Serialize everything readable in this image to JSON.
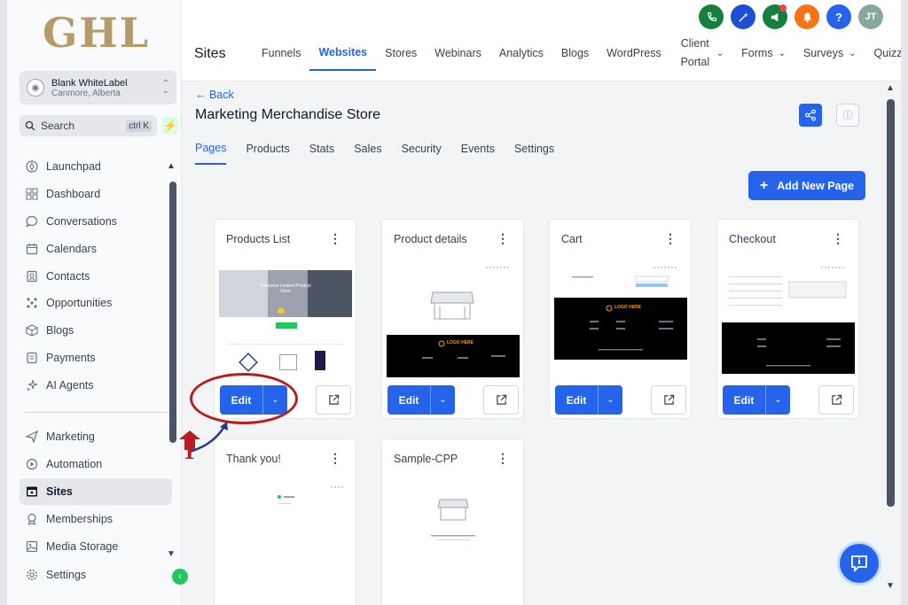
{
  "brand": {
    "logo_text": "GHL"
  },
  "account": {
    "name": "Blank WhiteLabel",
    "location": "Canmore, Alberta"
  },
  "search": {
    "label": "Search",
    "shortcut": "ctrl K"
  },
  "sidebar": {
    "items": [
      {
        "label": "Launchpad",
        "icon": "rocket-icon"
      },
      {
        "label": "Dashboard",
        "icon": "grid-icon"
      },
      {
        "label": "Conversations",
        "icon": "chat-icon"
      },
      {
        "label": "Calendars",
        "icon": "calendar-icon"
      },
      {
        "label": "Contacts",
        "icon": "contacts-icon"
      },
      {
        "label": "Opportunities",
        "icon": "opportunities-icon"
      },
      {
        "label": "Blogs",
        "icon": "cube-icon"
      },
      {
        "label": "Payments",
        "icon": "payments-icon"
      },
      {
        "label": "AI Agents",
        "icon": "sparkle-icon"
      }
    ],
    "items2": [
      {
        "label": "Marketing",
        "icon": "send-icon"
      },
      {
        "label": "Automation",
        "icon": "automation-icon"
      },
      {
        "label": "Sites",
        "icon": "sites-icon",
        "active": true
      },
      {
        "label": "Memberships",
        "icon": "badge-icon"
      },
      {
        "label": "Media Storage",
        "icon": "image-icon"
      },
      {
        "label": "Settings",
        "icon": "gear-icon"
      }
    ]
  },
  "topbar": {
    "section_title": "Sites",
    "tabs": [
      "Funnels",
      "Websites",
      "Stores",
      "Webinars",
      "Analytics",
      "Blogs",
      "WordPress",
      "Client Portal",
      "Forms",
      "Surveys",
      "Quizzes"
    ],
    "active_tab": "Websites",
    "user_initials": "JT",
    "help_label": "?"
  },
  "page": {
    "back_label": "← Back",
    "title": "Marketing Merchandise Store",
    "subtabs": [
      "Pages",
      "Products",
      "Stats",
      "Sales",
      "Security",
      "Events",
      "Settings"
    ],
    "active_subtab": "Pages",
    "add_button": "Add New Page",
    "edit_label": "Edit"
  },
  "cards": [
    {
      "title": "Products List"
    },
    {
      "title": "Product details"
    },
    {
      "title": "Cart"
    },
    {
      "title": "Checkout"
    },
    {
      "title": "Thank you!"
    },
    {
      "title": "Sample-CPP"
    }
  ],
  "thumb_text": {
    "banner": "Exclusive Limited Product Store",
    "logo_here": "LOGO HERE"
  },
  "annotation": {
    "step_number": "1"
  },
  "colors": {
    "accent": "#2563eb",
    "annotation": "#b91c1c",
    "brand_gold": "#b59a6a"
  }
}
